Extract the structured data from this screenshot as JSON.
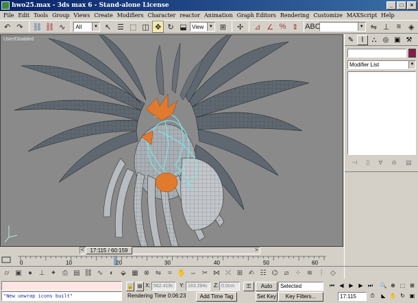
{
  "window": {
    "title": "hwo25.max - 3ds max 6 - Stand-alone License",
    "controls": {
      "minimize": "_",
      "maximize": "□",
      "close": "×"
    }
  },
  "menu": [
    "File",
    "Edit",
    "Tools",
    "Group",
    "Views",
    "Create",
    "Modifiers",
    "Character",
    "reactor",
    "Animation",
    "Graph Editors",
    "Rendering",
    "Customize",
    "MAXScript",
    "Help"
  ],
  "toolbar": {
    "selection_filter": "All",
    "reference_coord": "View"
  },
  "viewport": {
    "label": "User/Disabled"
  },
  "command_panel": {
    "modifier_list": "Modifier List"
  },
  "timeline": {
    "frame_display": "17:115 / 60:159",
    "prev_arrow": "<",
    "next_arrow": ">",
    "ticks": [
      "0",
      "10",
      "20",
      "30",
      "40",
      "50",
      "60"
    ]
  },
  "status": {
    "maxscript_output": "\"New unwrap icons built\"",
    "x_label": "X:",
    "x_value": "562.419c",
    "y_label": "Y:",
    "y_value": "163.294c",
    "z_label": "Z:",
    "z_value": "0.0cm",
    "rendering_time": "Rendering Time  0:06:23",
    "add_time_tag": "Add Time Tag"
  },
  "animation": {
    "auto_key": "Auto Key",
    "selected": "Selected",
    "set_key": "Set Key",
    "key_filters": "Key Filters...",
    "current_frame": "17:115"
  }
}
